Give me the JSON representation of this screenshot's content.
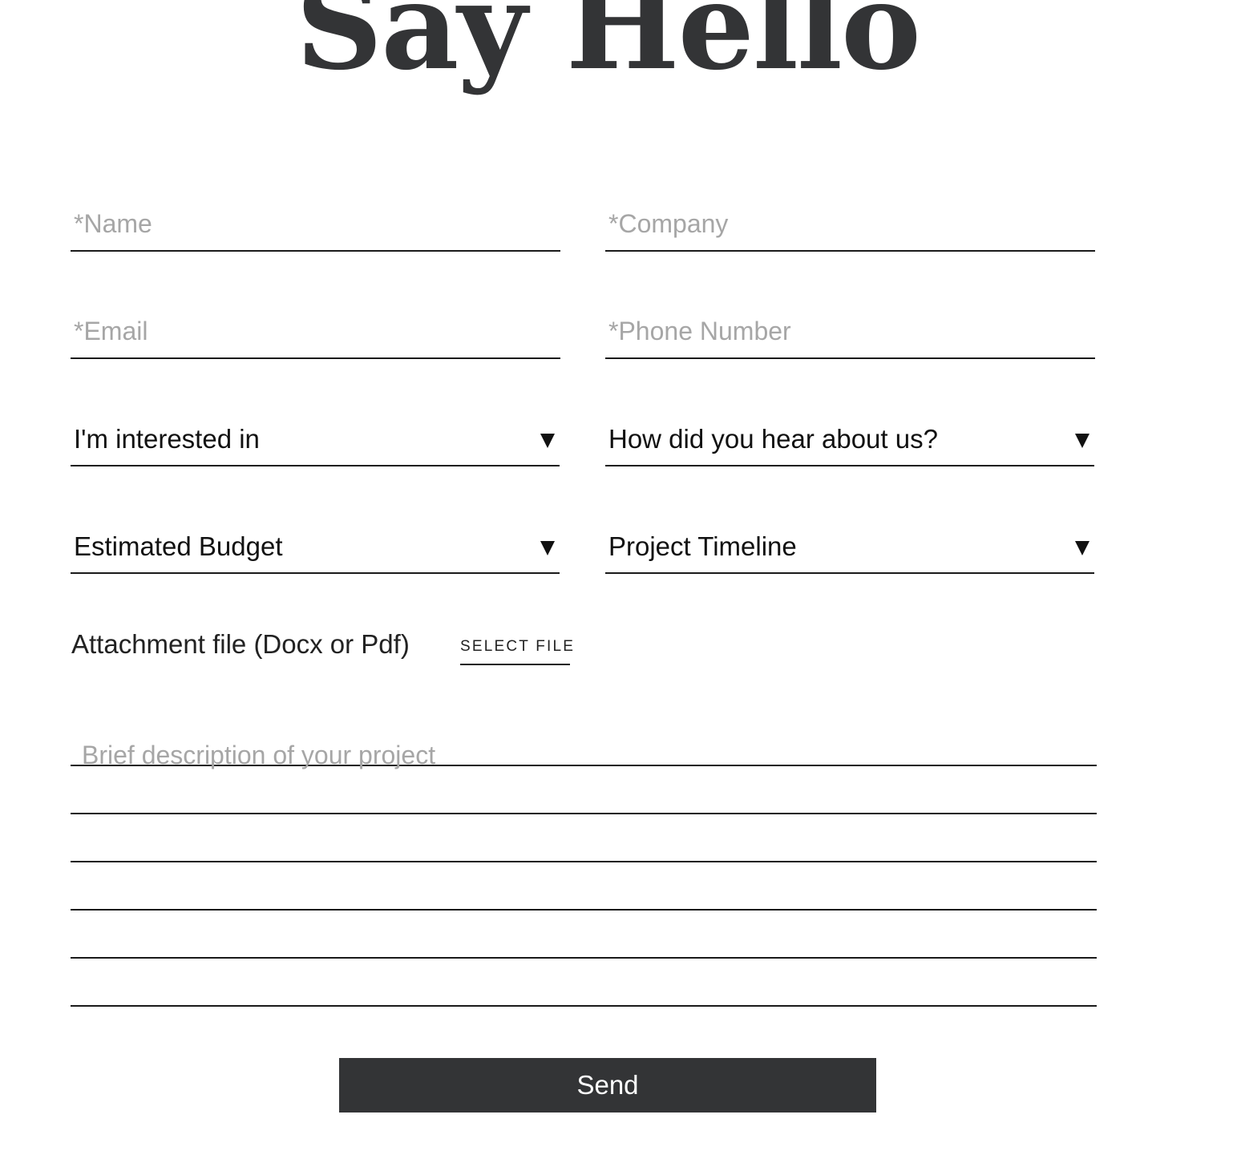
{
  "header": {
    "title": "Say Hello"
  },
  "form": {
    "name_placeholder": "*Name",
    "company_placeholder": "*Company",
    "email_placeholder": "*Email",
    "phone_placeholder": "*Phone Number",
    "interest_select": {
      "selected": "I'm interested in"
    },
    "source_select": {
      "selected": "How did you hear about us?"
    },
    "budget_select": {
      "selected": "Estimated Budget"
    },
    "timeline_select": {
      "selected": "Project Timeline"
    },
    "attachment": {
      "label": "Attachment file (Docx or Pdf)",
      "button_label": "SELECT FILE"
    },
    "description_placeholder": "Brief description of your project",
    "send_label": "Send"
  },
  "icons": {
    "dropdown": "caret-down-icon"
  },
  "colors": {
    "title": "#333436",
    "button_bg": "#333436",
    "button_text": "#ffffff",
    "placeholder": "#a6a6a6",
    "underline": "#1a1a1a"
  }
}
